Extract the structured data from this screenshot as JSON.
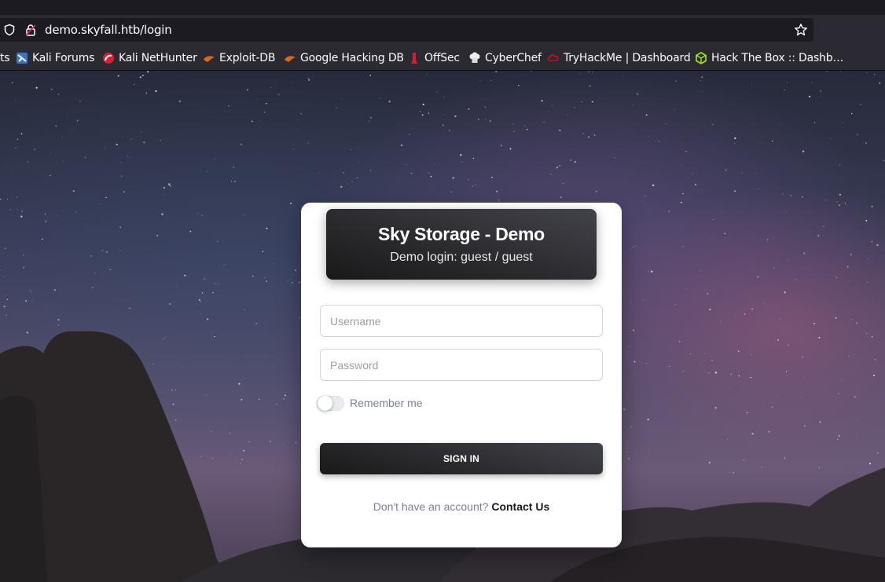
{
  "browser": {
    "url": "demo.skyfall.htb/login",
    "bookmarks": [
      {
        "label": "ts",
        "icon": "truncated-bookmark"
      },
      {
        "label": "Kali Forums",
        "icon": "kali-forums-icon"
      },
      {
        "label": "Kali NetHunter",
        "icon": "kali-nethunter-icon"
      },
      {
        "label": "Exploit-DB",
        "icon": "exploit-db-icon"
      },
      {
        "label": "Google Hacking DB",
        "icon": "ghdb-icon"
      },
      {
        "label": "OffSec",
        "icon": "offsec-icon"
      },
      {
        "label": "CyberChef",
        "icon": "cyberchef-icon"
      },
      {
        "label": "TryHackMe | Dashboard",
        "icon": "tryhackme-icon"
      },
      {
        "label": "Hack The Box :: Dashb…",
        "icon": "hackthebox-icon"
      }
    ]
  },
  "login": {
    "title": "Sky Storage - Demo",
    "subtitle": "Demo login: guest / guest",
    "username_placeholder": "Username",
    "password_placeholder": "Password",
    "remember_label": "Remember me",
    "remember_checked": false,
    "signin_label": "SIGN IN",
    "footer_question": "Don't have an account?",
    "footer_link": "Contact Us"
  },
  "colors": {
    "card_header": "#191919",
    "page_sky": "#3a3d58",
    "browser_chrome": "#2b2a33"
  }
}
